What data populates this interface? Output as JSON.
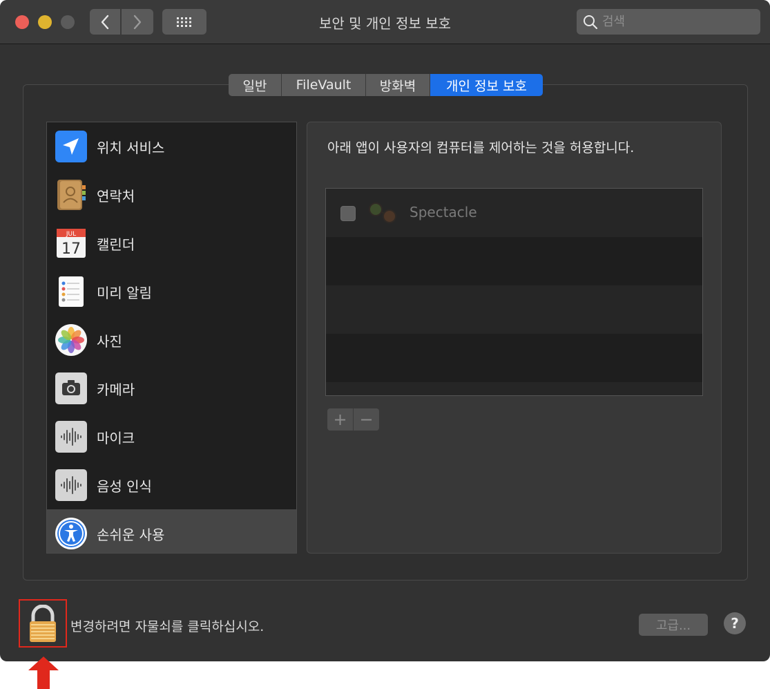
{
  "window": {
    "title": "보안 및 개인 정보 보호"
  },
  "search": {
    "placeholder": "검색"
  },
  "tabs": [
    {
      "label": "일반",
      "active": false
    },
    {
      "label": "FileVault",
      "active": false
    },
    {
      "label": "방화벽",
      "active": false
    },
    {
      "label": "개인 정보 보호",
      "active": true
    }
  ],
  "sidebar": {
    "items": [
      {
        "label": "위치 서비스",
        "icon": "location-arrow-icon",
        "selected": false
      },
      {
        "label": "연락처",
        "icon": "contacts-book-icon",
        "selected": false
      },
      {
        "label": "캘린더",
        "icon": "calendar-icon",
        "selected": false
      },
      {
        "label": "미리 알림",
        "icon": "reminders-icon",
        "selected": false
      },
      {
        "label": "사진",
        "icon": "photos-icon",
        "selected": false
      },
      {
        "label": "카메라",
        "icon": "camera-icon",
        "selected": false
      },
      {
        "label": "마이크",
        "icon": "microphone-waveform-icon",
        "selected": false
      },
      {
        "label": "음성 인식",
        "icon": "speech-waveform-icon",
        "selected": false
      },
      {
        "label": "손쉬운 사용",
        "icon": "accessibility-icon",
        "selected": true
      }
    ],
    "calendar_icon": {
      "month": "JUL",
      "day": "17"
    }
  },
  "main": {
    "instruction": "아래 앱이 사용자의 컴퓨터를 제어하는 것을 허용합니다.",
    "apps": [
      {
        "name": "Spectacle",
        "checked": false,
        "icon": "spectacle-glasses-icon"
      }
    ],
    "add_label": "+",
    "remove_label": "−"
  },
  "footer": {
    "lock_text": "변경하려면 자물쇠를 클릭하십시오.",
    "advanced_label": "고급...",
    "help_label": "?"
  },
  "colors": {
    "accent": "#1c6fe8",
    "annotation": "#e0281c",
    "window_bg": "#323232"
  }
}
